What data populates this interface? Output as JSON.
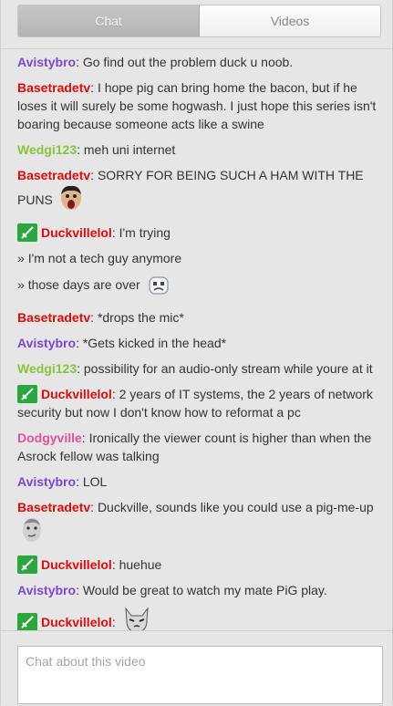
{
  "tabs": {
    "chat": "Chat",
    "videos": "Videos"
  },
  "colors": {
    "purple": "#7b46d6",
    "red": "#e20a0a",
    "green": "#86c43a",
    "pink": "#e6509a",
    "mod_badge": "#2aa83e"
  },
  "messages": [
    {
      "user": "Avistybro",
      "sep": ": ",
      "text": "Go find out the problem duck u noob."
    },
    {
      "user": "Basetradetv",
      "sep": ": ",
      "text": "I hope pig can bring home the bacon, but if he loses it will surely be some hogwash. I just hope this series isn't boaring because someone acts like a swine"
    },
    {
      "user": "Wedgi123",
      "sep": ": ",
      "text": "meh uni internet"
    },
    {
      "user": "Basetradetv",
      "sep": ": ",
      "text": "SORRY FOR BEING SUCH A HAM WITH THE PUNS"
    },
    {
      "user": "Duckvillelol",
      "sep": ": ",
      "text": "I'm trying"
    },
    {
      "prefix": "» ",
      "text": "I'm not a tech guy anymore"
    },
    {
      "prefix": "» ",
      "text": "those days are over"
    },
    {
      "user": "Basetradetv",
      "sep": ": ",
      "text": "*drops the mic*"
    },
    {
      "user": "Avistybro",
      "sep": ": ",
      "text": "*Gets kicked in the head*"
    },
    {
      "user": "Wedgi123",
      "sep": ": ",
      "text": "possibility for an audio-only stream while youre at it"
    },
    {
      "user": "Duckvillelol",
      "sep": ": ",
      "text": "2 years of IT systems, the 2 years of network security but now I don't know how to reformat a pc"
    },
    {
      "user": "Dodgyville",
      "sep": ": ",
      "text": "Ironically the viewer count is higher than when the Asrock fellow was talking"
    },
    {
      "user": "Avistybro",
      "sep": ": ",
      "text": "LOL"
    },
    {
      "user": "Basetradetv",
      "sep": ": ",
      "text": "Duckville, sounds like you could use a pig-me-up"
    },
    {
      "user": "Duckvillelol",
      "sep": ": ",
      "text": "huehue"
    },
    {
      "user": "Avistybro",
      "sep": ": ",
      "text": "Would be great to watch my mate PiG play."
    },
    {
      "user": "Duckvillelol",
      "sep": ": ",
      "text": ""
    }
  ],
  "input": {
    "placeholder": "Chat about this video"
  },
  "icons": {
    "mod_badge": "sword-badge-icon",
    "emotes": [
      "scream-face-emote-icon",
      "sad-robot-emote-icon",
      "kappa-face-emote-icon",
      "cat-face-emote-icon"
    ]
  }
}
